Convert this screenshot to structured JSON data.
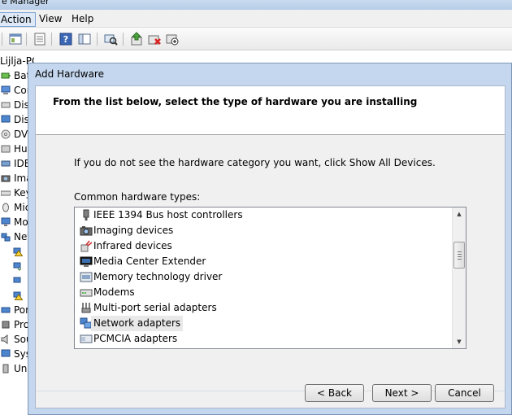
{
  "background_window": {
    "title": "e Manager",
    "menu": [
      "Action",
      "View",
      "Help"
    ],
    "active_menu": "Action",
    "tree_root": "Lijlja-PC",
    "tree_items": [
      "Bat",
      "Cor",
      "Dis",
      "Dis",
      "DVI",
      "Hur",
      "IDE",
      "Ima",
      "Key",
      "Mic",
      "Mo",
      "Net",
      "",
      "",
      "",
      "",
      "Por",
      "Pro",
      "Sou",
      "Sys",
      "Uni"
    ]
  },
  "dialog": {
    "title": "Add Hardware",
    "heading": "From the list below, select the type of hardware you are installing",
    "instruction": "If you do not see the hardware category you want, click Show All Devices.",
    "list_label": "Common hardware types:",
    "items": [
      {
        "label": "IEEE 1394 Bus host controllers",
        "icon": "firewire-icon"
      },
      {
        "label": "Imaging devices",
        "icon": "camera-icon"
      },
      {
        "label": "Infrared devices",
        "icon": "infrared-icon"
      },
      {
        "label": "Media Center Extender",
        "icon": "monitor-icon"
      },
      {
        "label": "Memory technology driver",
        "icon": "memory-icon"
      },
      {
        "label": "Modems",
        "icon": "modem-icon"
      },
      {
        "label": "Multi-port serial adapters",
        "icon": "serial-port-icon"
      },
      {
        "label": "Network adapters",
        "icon": "network-icon"
      },
      {
        "label": "PCMCIA adapters",
        "icon": "pcmcia-icon"
      }
    ],
    "selected_item": "Network adapters",
    "buttons": {
      "back": "< Back",
      "next": "Next >",
      "cancel": "Cancel"
    }
  }
}
